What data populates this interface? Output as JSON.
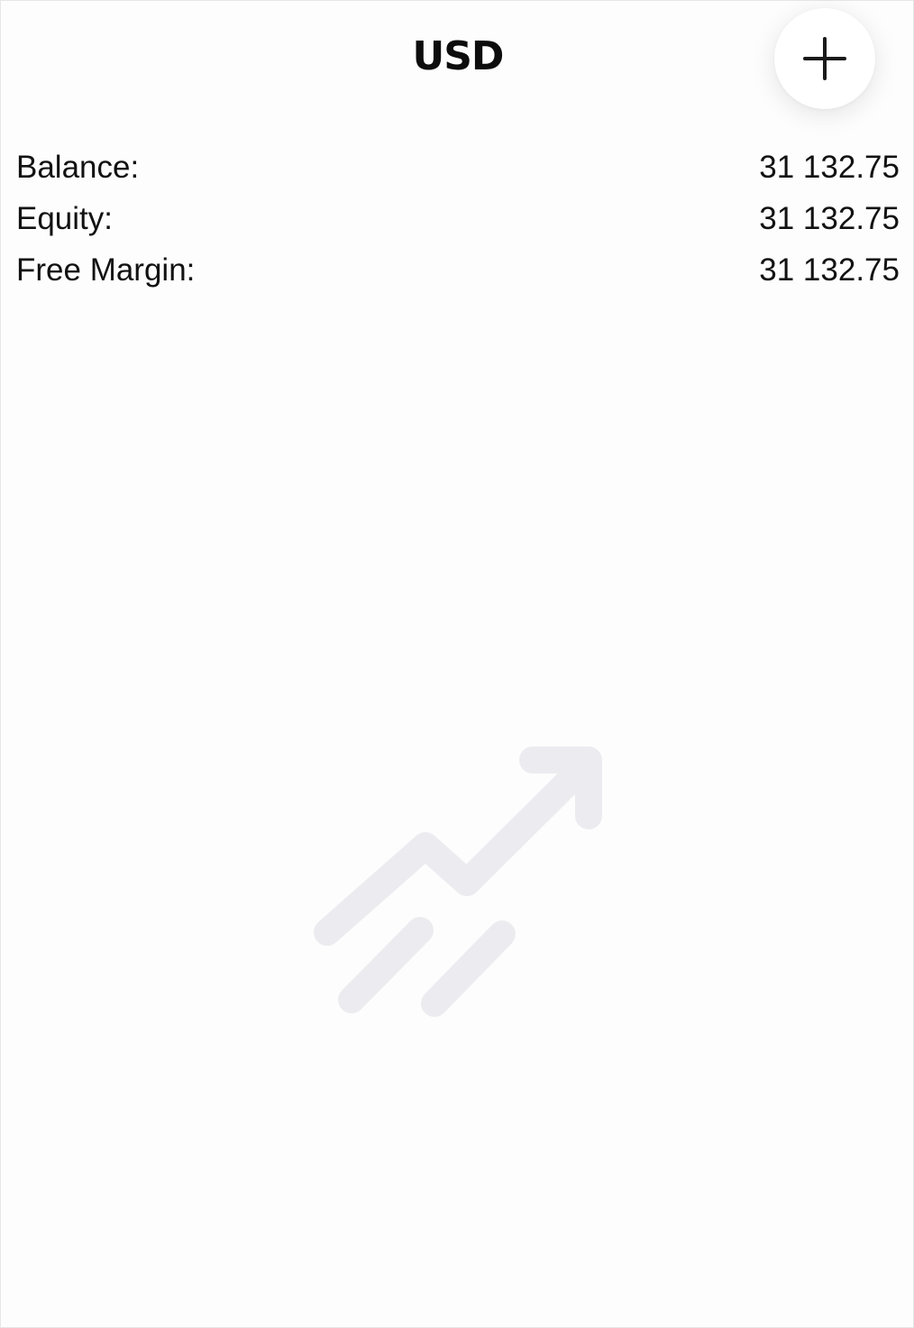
{
  "header": {
    "title": "USD",
    "add_icon": "plus-icon"
  },
  "account": {
    "rows": [
      {
        "label": "Balance:",
        "value": "31 132.75"
      },
      {
        "label": "Equity:",
        "value": "31 132.75"
      },
      {
        "label": "Free Margin:",
        "value": "31 132.75"
      }
    ]
  },
  "empty_state": {
    "icon": "trending-up-chart-icon",
    "icon_color": "#ececf0"
  },
  "colors": {
    "background": "#ffffff",
    "text": "#121212"
  }
}
